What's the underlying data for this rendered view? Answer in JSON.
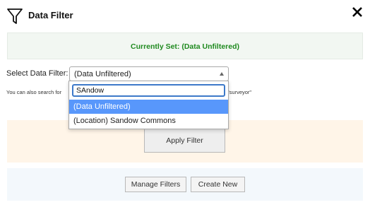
{
  "header": {
    "title": "Data Filter"
  },
  "current": {
    "text": "Currently Set: (Data Unfiltered)"
  },
  "select": {
    "label": "Select Data Filter:",
    "value": "(Data Unfiltered)"
  },
  "hint": {
    "prefix": "You can also search for",
    "suffix": "\"surveyor\""
  },
  "dropdown": {
    "search_value": "SAndow",
    "options": [
      {
        "label": "(Data Unfiltered)",
        "selected": true
      },
      {
        "label": "(Location) Sandow Commons",
        "selected": false
      }
    ]
  },
  "buttons": {
    "apply": "Apply Filter",
    "manage": "Manage Filters",
    "create": "Create New"
  },
  "colors": {
    "current_text": "#1f8a1f",
    "current_bg": "#f2f7f2",
    "apply_bg": "#fff5e8",
    "manage_bg": "#f3f8fc",
    "selected_option": "#5897fb",
    "search_border": "#3d79c9"
  }
}
